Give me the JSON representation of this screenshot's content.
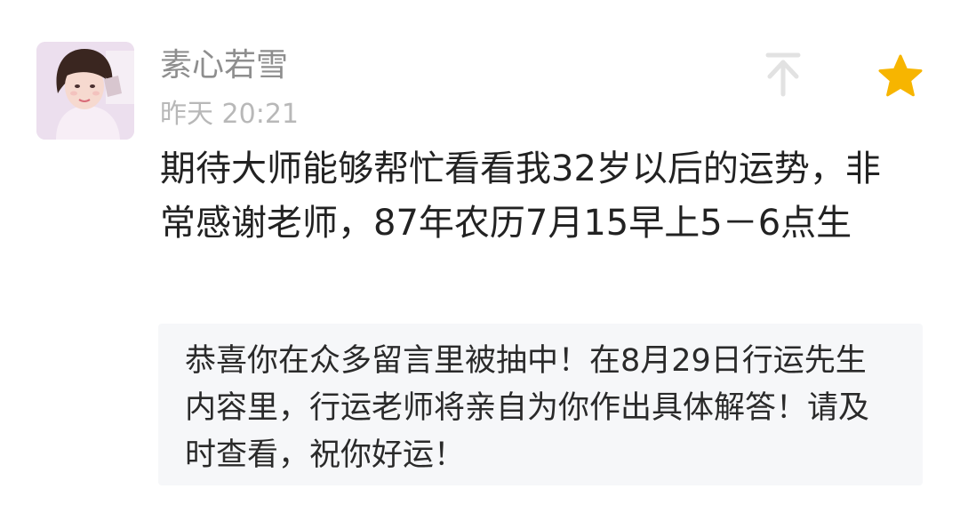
{
  "comment": {
    "username": "素心若雪",
    "timestamp": "昨天 20:21",
    "body": "期待大师能够帮忙看看我32岁以后的运势，非常感谢老师，87年农历7月15早上5－6点生",
    "reply": "恭喜你在众多留言里被抽中！在8月29日行运先生内容里，行运老师将亲自为你作出具体解答！请及时查看，祝你好运！"
  },
  "icons": {
    "pin": "pin-to-top-icon",
    "star": "star-icon"
  },
  "colors": {
    "star": "#f7b500",
    "pin": "#e2e2e2",
    "username": "#8e8e8e",
    "timestamp": "#b8b8b8",
    "body_text": "#222222",
    "reply_background": "#f6f7f9"
  }
}
